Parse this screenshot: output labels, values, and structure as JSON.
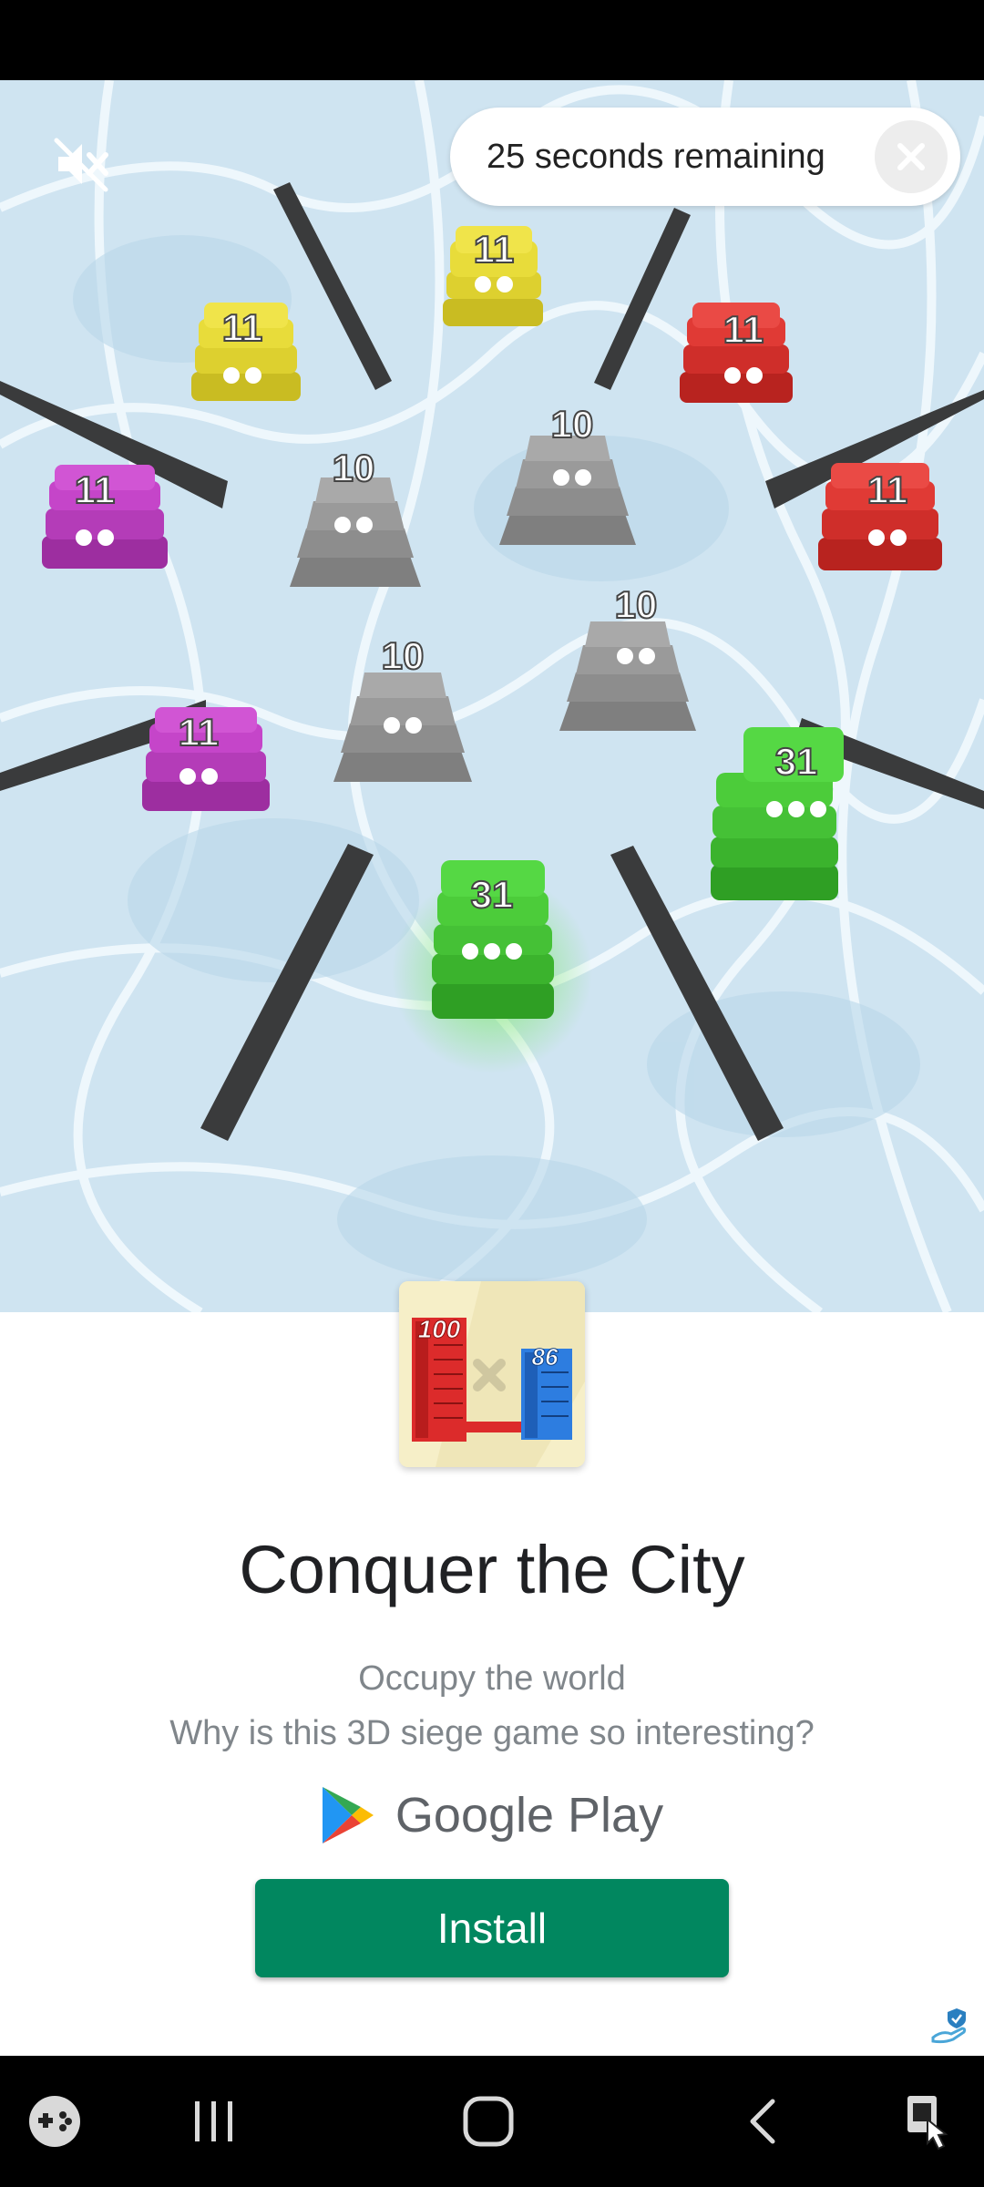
{
  "ad": {
    "timer_text": "25 seconds remaining",
    "close_icon": "close-icon",
    "mute_icon": "volume-off-icon"
  },
  "game_scene": {
    "towers": [
      {
        "value": "11",
        "color": "#e8dc3a"
      },
      {
        "value": "11",
        "color": "#e8dc3a"
      },
      {
        "value": "11",
        "color": "#e03a35"
      },
      {
        "value": "11",
        "color": "#e03a35"
      },
      {
        "value": "11",
        "color": "#c545c9"
      },
      {
        "value": "11",
        "color": "#c545c9"
      },
      {
        "value": "10",
        "color": "#9a9a9a"
      },
      {
        "value": "10",
        "color": "#9a9a9a"
      },
      {
        "value": "10",
        "color": "#9a9a9a"
      },
      {
        "value": "10",
        "color": "#9a9a9a"
      },
      {
        "value": "31",
        "color": "#4ccc3a"
      },
      {
        "value": "31",
        "color": "#4ccc3a"
      }
    ]
  },
  "app": {
    "icon_numbers": [
      "100",
      "86"
    ],
    "title": "Conquer the City",
    "description_line1": "Occupy the world",
    "description_line2": "Why is this 3D siege game so interesting?",
    "store_name": "Google Play",
    "install_label": "Install"
  },
  "colors": {
    "install_button": "#01875f",
    "title_text": "#202124",
    "desc_text": "#80868b"
  },
  "nav": {
    "icons": [
      "game-launcher-icon",
      "recent-apps-icon",
      "home-icon",
      "back-icon",
      "accessibility-icon"
    ]
  }
}
